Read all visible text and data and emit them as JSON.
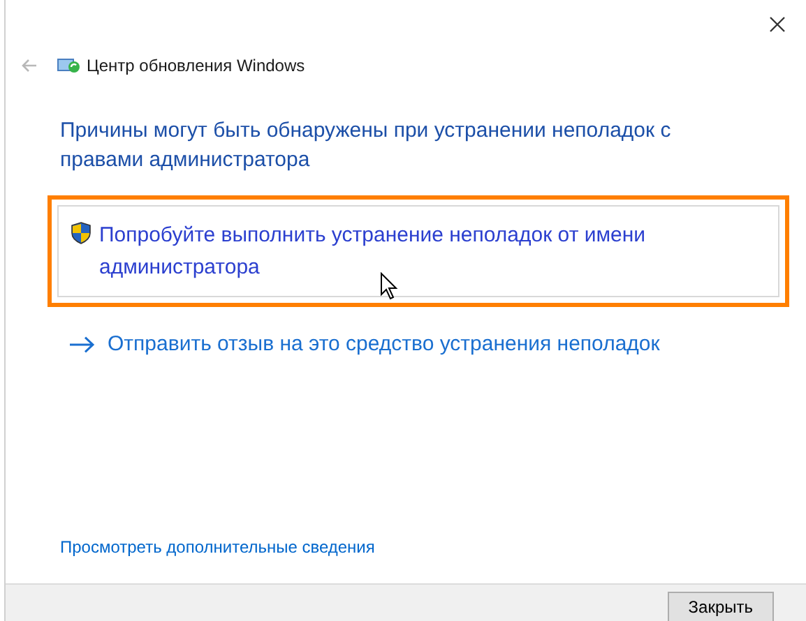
{
  "window": {
    "title": "Центр обновления Windows"
  },
  "heading": "Причины могут быть обнаружены при устранении неполадок с правами администратора",
  "options": [
    {
      "kind": "admin",
      "label": "Попробуйте выполнить устранение неполадок от имени администратора",
      "highlighted": true
    },
    {
      "kind": "feedback",
      "label": "Отправить отзыв на это средство устранения неполадок",
      "highlighted": false
    }
  ],
  "details_link": "Просмотреть дополнительные сведения",
  "footer": {
    "buttons": [
      "Закрыть"
    ]
  }
}
